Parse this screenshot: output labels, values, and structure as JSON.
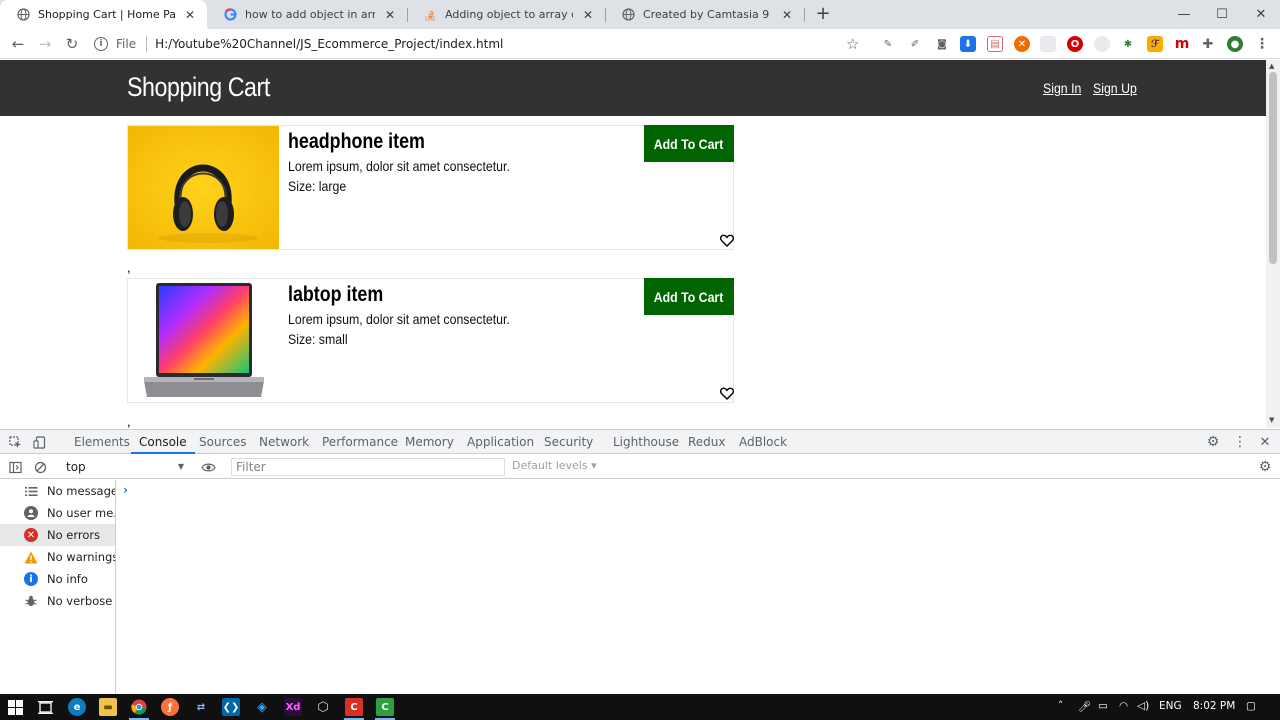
{
  "browser": {
    "tabs": [
      {
        "title": "Shopping Cart | Home Page",
        "favicon": "globe-icon",
        "active": true
      },
      {
        "title": "how to add object in array after c",
        "favicon": "google-icon",
        "active": false
      },
      {
        "title": "Adding object to array onclick Ja",
        "favicon": "stackoverflow-icon",
        "active": false
      },
      {
        "title": "Created by Camtasia 9",
        "favicon": "globe-icon",
        "active": false
      }
    ],
    "new_tab": "+",
    "window": {
      "minimize": "—",
      "maximize": "☐",
      "close": "✕"
    },
    "address": {
      "scheme": "File",
      "url": "H:/Youtube%20Channel/JS_Ecommerce_Project/index.html"
    }
  },
  "site": {
    "brand": "Shopping Cart",
    "nav": {
      "signin": "Sign In",
      "signup": "Sign Up"
    },
    "products": [
      {
        "name": "headphone item",
        "desc": "Lorem ipsum, dolor sit amet consectetur.",
        "size": "Size: large",
        "button": "Add To Cart",
        "image": "headphones-image"
      },
      {
        "name": "labtop item",
        "desc": "Lorem ipsum, dolor sit amet consectetur.",
        "size": "Size: small",
        "button": "Add To Cart",
        "image": "laptop-image"
      }
    ],
    "separator": ","
  },
  "devtools": {
    "tabs": [
      "Elements",
      "Console",
      "Sources",
      "Network",
      "Performance",
      "Memory",
      "Application",
      "Security",
      "Lighthouse",
      "Redux",
      "AdBlock"
    ],
    "active_tab": "Console",
    "context": "top",
    "filter_placeholder": "Filter",
    "levels": "Default levels ▾",
    "sidebar": [
      {
        "label": "No messages",
        "icon": "list-icon",
        "color": "#5f6368"
      },
      {
        "label": "No user me...",
        "icon": "user-icon",
        "color": "#5f6368"
      },
      {
        "label": "No errors",
        "icon": "error-icon",
        "color": "#d93025"
      },
      {
        "label": "No warnings",
        "icon": "warning-icon",
        "color": "#f29900"
      },
      {
        "label": "No info",
        "icon": "info-icon",
        "color": "#1a73e8"
      },
      {
        "label": "No verbose",
        "icon": "bug-icon",
        "color": "#5f6368"
      }
    ],
    "prompt": "›"
  },
  "taskbar": {
    "lang": "ENG",
    "time": "8:02 PM"
  },
  "colors": {
    "add_to_cart": "#006400",
    "site_header": "#323232",
    "accent": "#1a73e8"
  }
}
